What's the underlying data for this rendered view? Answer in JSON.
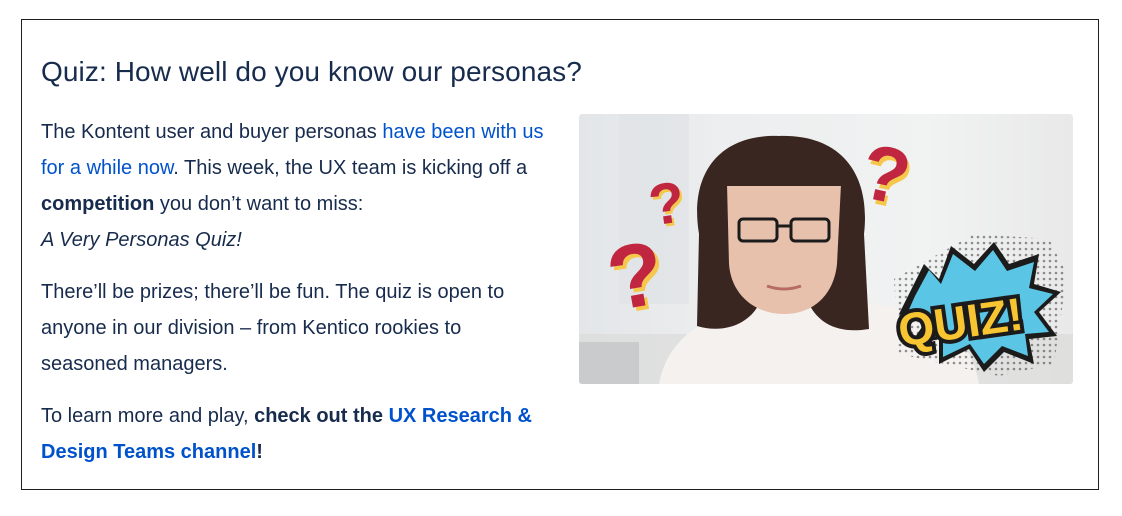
{
  "heading": "Quiz: How well do you know our personas?",
  "paragraph1": {
    "text_a": "The Kontent user and buyer personas ",
    "link": "have been with us for a while now",
    "text_b": ". This week, the UX team is kicking off a ",
    "bold": "competition",
    "text_c": " you don’t want to miss:",
    "italic": "A Very Personas Quiz!"
  },
  "paragraph2": "There’ll be prizes; there’ll be fun. The quiz is open to anyone in our division – from Kentico rookies to seasoned managers.",
  "paragraph3": {
    "text_a": "To learn more and play, ",
    "bold": "check out the ",
    "link": "UX Research & Design Teams channel",
    "text_b": "!"
  },
  "image": {
    "badge_text": "QUIZ!",
    "question_mark": "?",
    "colors": {
      "question": "#c0263f",
      "question_shadow": "#f5c84c",
      "badge_yellow": "#f7c531",
      "badge_blue": "#5bc5e6",
      "hair": "#3a2620",
      "shirt": "#f4f1ee"
    }
  }
}
